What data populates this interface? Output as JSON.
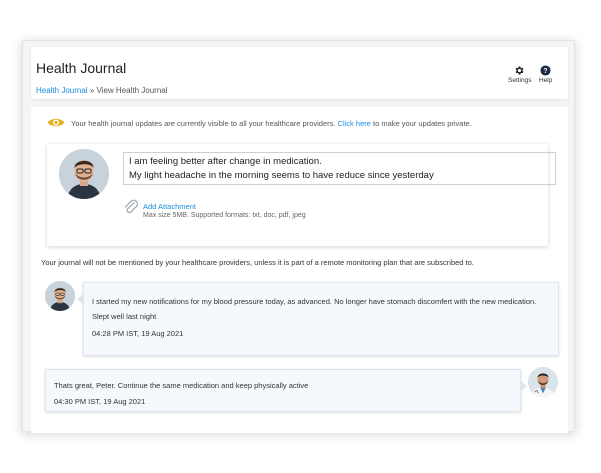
{
  "header": {
    "title": "Health Journal",
    "breadcrumb": {
      "link": "Health Journal",
      "separator": "»",
      "current": "View Health Journal"
    },
    "settings_label": "Settings",
    "help_label": "Help"
  },
  "notice": {
    "text": "Your health journal updates are currently visible to all your healthcare providers.",
    "link": "Click here",
    "suffix": "to make your updates private.",
    "icon": "eye-icon"
  },
  "compose": {
    "line1": "I am feeling better after change in medication.",
    "line2": "My light headache in the morning seems to have reduce since yesterday",
    "attach_label": "Add Attachment",
    "attach_hint": "Max size 5MB. Supported formats: txt, doc, pdf, jpeg"
  },
  "disclaimer": "Your journal will not be mentioned by your healthcare providers, unless it is part of a remote monitoring plan that are subscribed to.",
  "messages": [
    {
      "text": "I started my new notifications for my blood pressure today, as advanced. No longer have stomach discomfert with the new medication. Slept well last night",
      "timestamp": "04:28 PM IST, 19 Aug 2021"
    },
    {
      "text": "Thats great, Peter. Continue the same medication and keep physically active",
      "timestamp": "04:30 PM IST, 19 Aug 2021"
    }
  ],
  "colors": {
    "link": "#1a8fe0",
    "eye_icon": "#e8b020",
    "bubble": "#f5f8fc"
  }
}
